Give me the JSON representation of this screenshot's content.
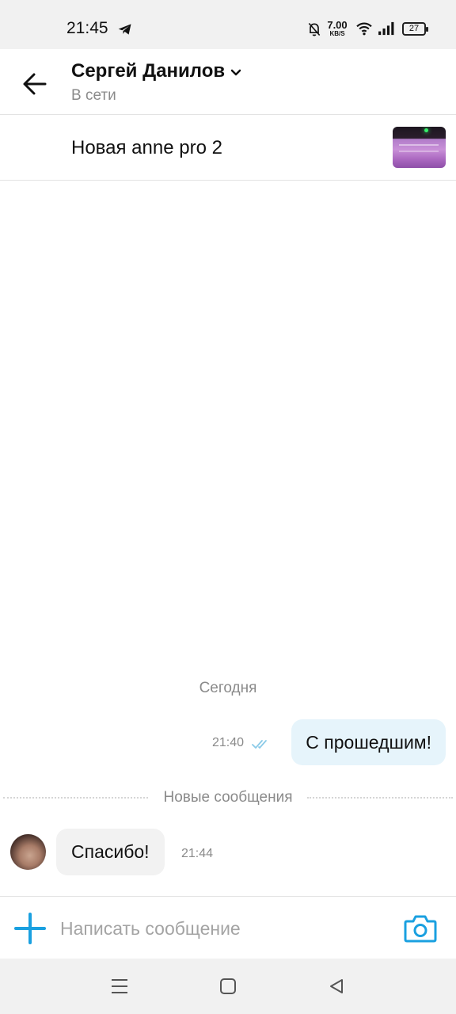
{
  "status_bar": {
    "time": "21:45",
    "net_speed_value": "7.00",
    "net_speed_unit": "KB/S",
    "battery": "27",
    "icons": [
      "telegram-icon",
      "bell-off-icon",
      "wifi-icon",
      "signal-icon",
      "battery-icon"
    ]
  },
  "header": {
    "back_icon": "arrow-left-icon",
    "contact_name": "Сергей Данилов",
    "status": "В сети"
  },
  "ad": {
    "title": "Новая anne pro 2"
  },
  "chat": {
    "date_separator": "Сегодня",
    "new_messages_separator": "Новые сообщения",
    "messages": [
      {
        "direction": "outgoing",
        "text": "С прошедшим!",
        "time": "21:40",
        "read": true
      },
      {
        "direction": "incoming",
        "text": "Спасибо!",
        "time": "21:44"
      }
    ]
  },
  "input": {
    "placeholder": "Написать сообщение",
    "value": ""
  },
  "colors": {
    "accent": "#1aa0e0",
    "outgoing_bubble": "#e6f4fb",
    "incoming_bubble": "#f2f2f2",
    "secondary_text": "#8a8a8a"
  }
}
